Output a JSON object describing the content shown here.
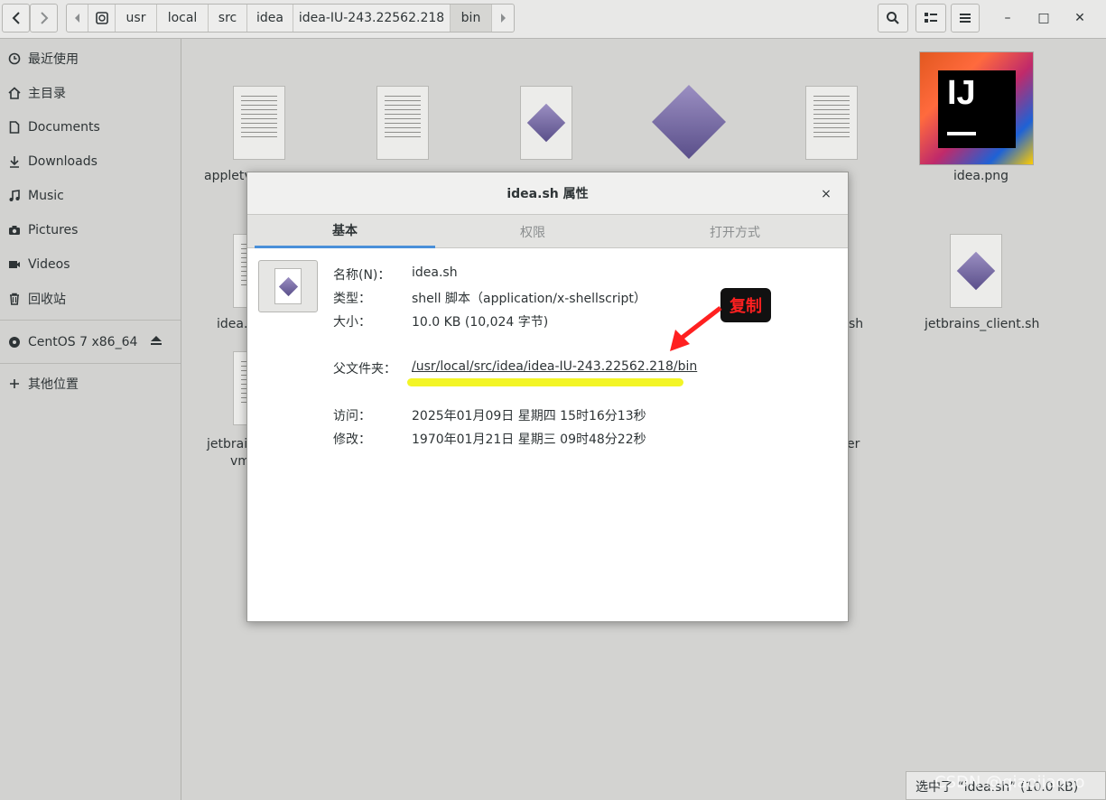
{
  "header": {
    "back_icon": "chevron-left-icon",
    "forward_icon": "chevron-right-icon",
    "breadcrumb_prev_icon": "chevron-left-small-icon",
    "breadcrumb_next_icon": "chevron-right-small-icon",
    "breadcrumb": [
      "usr",
      "local",
      "src",
      "idea",
      "idea-IU-243.22562.218",
      "bin"
    ],
    "active_crumb": "bin",
    "search_icon": "search-icon",
    "view_icon": "list-view-icon",
    "menu_icon": "hamburger-menu-icon",
    "minimize": "–",
    "maximize": "□",
    "close": "✕"
  },
  "sidebar": {
    "items": [
      {
        "label": "最近使用",
        "icon": "clock-icon"
      },
      {
        "label": "主目录",
        "icon": "home-icon"
      },
      {
        "label": "Documents",
        "icon": "document-icon"
      },
      {
        "label": "Downloads",
        "icon": "download-icon"
      },
      {
        "label": "Music",
        "icon": "music-icon"
      },
      {
        "label": "Pictures",
        "icon": "camera-icon"
      },
      {
        "label": "Videos",
        "icon": "video-icon"
      },
      {
        "label": "回收站",
        "icon": "trash-icon"
      }
    ],
    "devices": [
      {
        "label": "CentOS 7 x86_64",
        "icon": "disc-icon"
      }
    ],
    "other": {
      "label": "其他位置",
      "icon": "plus-icon"
    }
  },
  "files": {
    "row1": [
      "appletv",
      "idea.png"
    ],
    "row2": [
      "idea.p",
      "sh",
      "jetbrains_client.sh"
    ],
    "row3_left": "jetbrain",
    "row3_left2": "vm",
    "row3_right": "er"
  },
  "dialog": {
    "title": "idea.sh 属性",
    "close": "×",
    "tabs": [
      "基本",
      "权限",
      "打开方式"
    ],
    "rows": {
      "name_label": "名称(N)：",
      "name_value": "idea.sh",
      "type_label": "类型：",
      "type_value": "shell 脚本（application/x-shellscript）",
      "size_label": "大小：",
      "size_value": "10.0 KB (10,024 字节)",
      "parent_label": "父文件夹：",
      "parent_value": "/usr/local/src/idea/idea-IU-243.22562.218/bin",
      "access_label": "访问：",
      "access_value": "2025年01月09日 星期四 15时16分13秒",
      "modified_label": "修改：",
      "modified_value": "1970年01月21日 星期三 09时48分22秒"
    }
  },
  "annotation": {
    "copy": "复制"
  },
  "status": {
    "text": "选中了 “idea.sh” (10.0 kB)"
  },
  "watermark": "CSDN @qiaojiaoco",
  "colors": {
    "accent": "#4a90d9",
    "highlight": "#f2f41a",
    "badge_text": "#ff2020"
  }
}
